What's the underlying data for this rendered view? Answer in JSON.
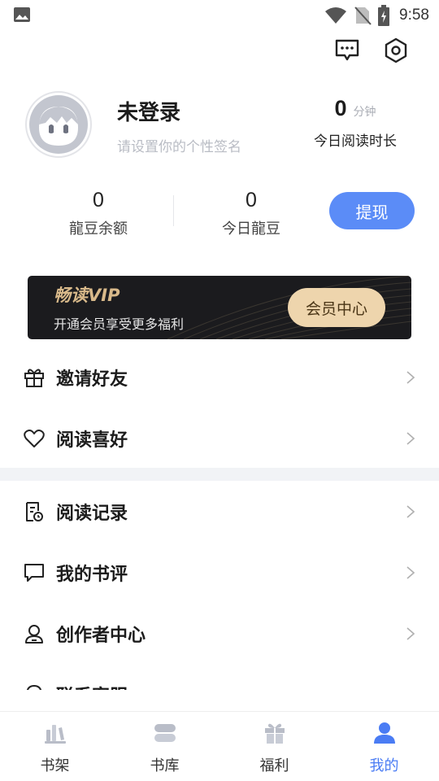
{
  "status_bar": {
    "time": "9:58",
    "icons": [
      "gallery-icon",
      "wifi-icon",
      "no-sim-icon",
      "battery-icon"
    ]
  },
  "header": {
    "icons": [
      "message-icon",
      "settings-icon"
    ]
  },
  "profile": {
    "username": "未登录",
    "signature_placeholder": "请设置你的个性签名",
    "read_time_value": "0",
    "read_time_unit": "分钟",
    "read_time_label": "今日阅读时长"
  },
  "stats": {
    "balance_value": "0",
    "balance_label": "龍豆余额",
    "today_value": "0",
    "today_label": "今日龍豆",
    "withdraw_label": "提现"
  },
  "vip": {
    "title": "畅读VIP",
    "subtitle": "开通会员享受更多福利",
    "button_label": "会员中心",
    "colors": {
      "background": "#1b1b1e",
      "gold": "#d8b98a",
      "button": "#eed5ad"
    }
  },
  "menu": {
    "group1": [
      {
        "label": "邀请好友",
        "icon": "gift-icon"
      },
      {
        "label": "阅读喜好",
        "icon": "heart-icon"
      }
    ],
    "group2": [
      {
        "label": "阅读记录",
        "icon": "reading-history-icon"
      },
      {
        "label": "我的书评",
        "icon": "comment-icon"
      },
      {
        "label": "创作者中心",
        "icon": "author-icon"
      }
    ],
    "partial_item_label": "联系客服"
  },
  "tab_bar": {
    "tabs": [
      {
        "label": "书架",
        "icon": "bookshelf-icon",
        "active": false
      },
      {
        "label": "书库",
        "icon": "library-icon",
        "active": false
      },
      {
        "label": "福利",
        "icon": "gift-tab-icon",
        "active": false
      },
      {
        "label": "我的",
        "icon": "profile-icon",
        "active": true
      }
    ],
    "active_color": "#4a7cf4"
  },
  "accent_color": "#5b8cf7"
}
